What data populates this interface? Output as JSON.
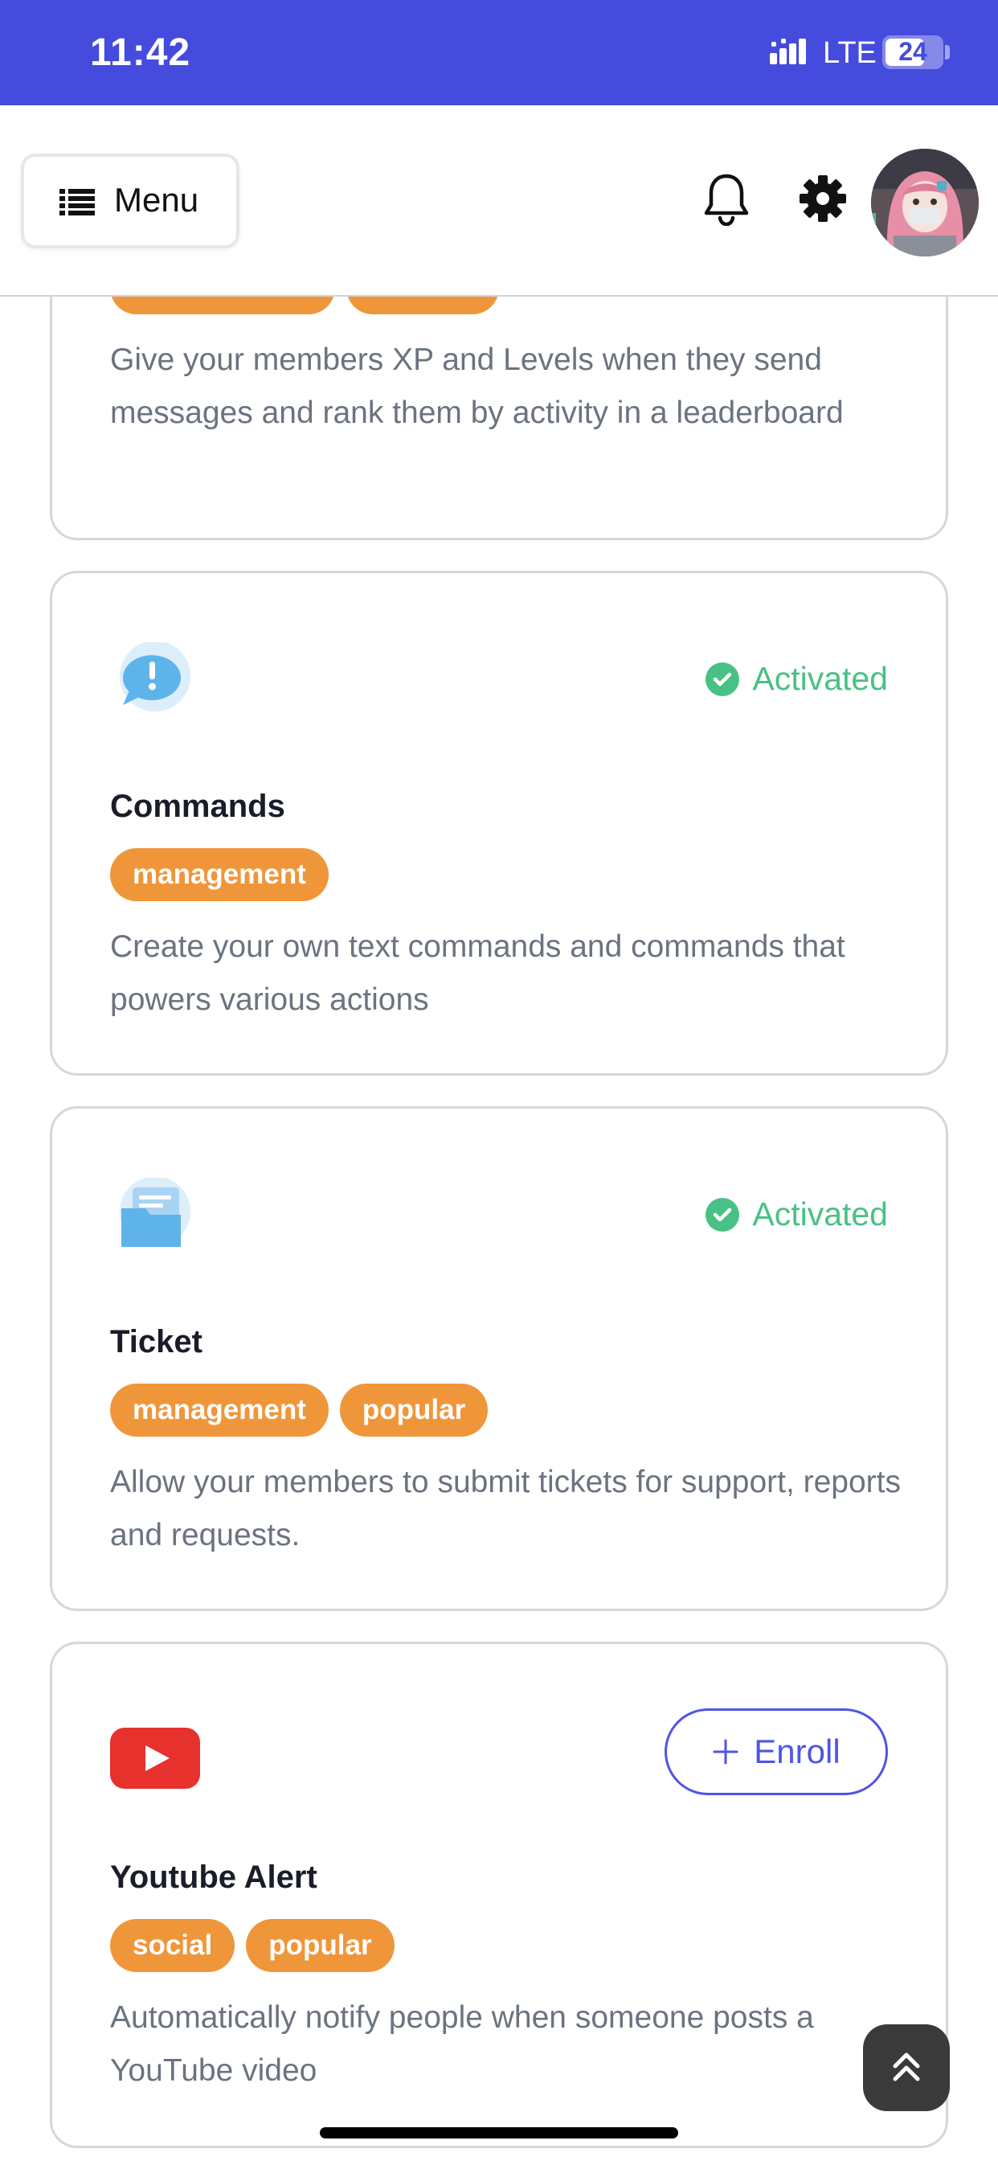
{
  "status_bar": {
    "time": "11:42",
    "network": "LTE",
    "battery": "24"
  },
  "header": {
    "menu_label": "Menu"
  },
  "cards": [
    {
      "title": "",
      "tags": [],
      "description": "Give your members XP and Levels when they send messages and rank them by activity in a leaderboard"
    },
    {
      "title": "Commands",
      "tags": [
        "management"
      ],
      "status": "Activated",
      "description": "Create your own text commands and commands that powers various actions"
    },
    {
      "title": "Ticket",
      "tags": [
        "management",
        "popular"
      ],
      "status": "Activated",
      "description": "Allow your members to submit tickets for support, reports and requests."
    },
    {
      "title": "Youtube Alert",
      "tags": [
        "social",
        "popular"
      ],
      "button": "Enroll",
      "description": "Automatically notify people when someone posts a YouTube video"
    }
  ],
  "colors": {
    "status_bar": "#444bdd",
    "tag": "#f0963a",
    "activated": "#49c184",
    "enroll": "#4f55e3",
    "youtube": "#e6312d"
  }
}
